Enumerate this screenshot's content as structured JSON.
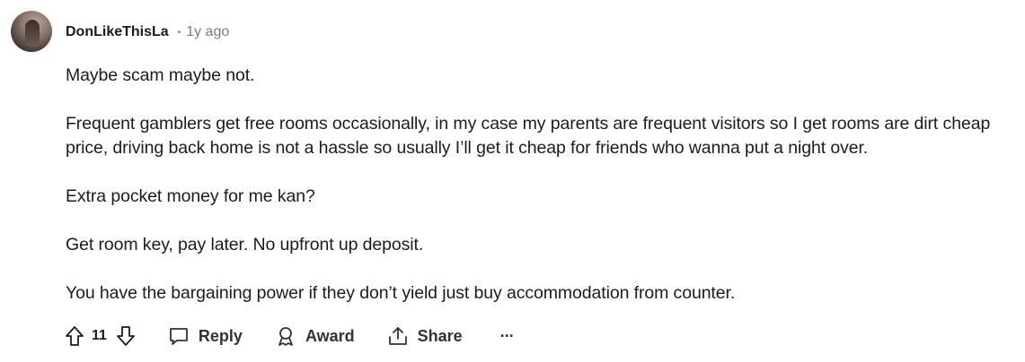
{
  "comment": {
    "author": "DonLikeThisLa",
    "separator": "•",
    "time": "1y ago",
    "paragraphs": [
      "Maybe scam maybe not.",
      "Frequent gamblers get free rooms occasionally, in my case my parents are frequent visitors so I get rooms are dirt cheap price, driving back home is not a hassle so usually I’ll get it cheap for friends who wanna put a night over.",
      "Extra pocket money for me kan?",
      "Get room key, pay later. No upfront up deposit.",
      "You have the bargaining power if they don’t yield just buy accommodation from counter."
    ]
  },
  "actions": {
    "score": "11",
    "reply_label": "Reply",
    "award_label": "Award",
    "share_label": "Share",
    "more_label": "···",
    "icons": {
      "upvote": "upvote-arrow-icon",
      "downvote": "downvote-arrow-icon",
      "reply": "speech-bubble-icon",
      "award": "award-ribbon-icon",
      "share": "share-upload-icon"
    }
  }
}
